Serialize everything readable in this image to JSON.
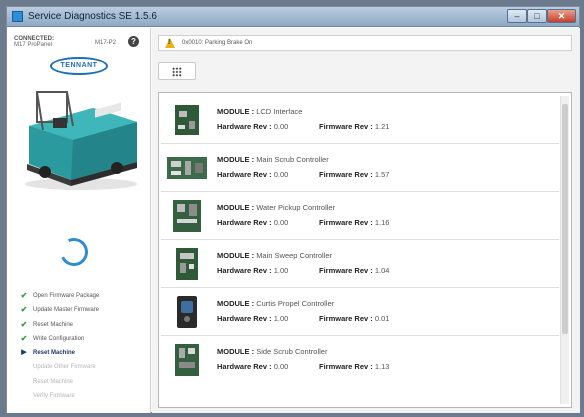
{
  "window": {
    "title": "Service Diagnostics SE 1.5.6",
    "min": "–",
    "max": "□",
    "close": "✕"
  },
  "connection": {
    "label": "CONNECTED:",
    "device": "M17 ProPanel",
    "model": "M17-P2",
    "help": "?"
  },
  "brand": {
    "logo": "TENNANT",
    "accent": "#1f6fb5"
  },
  "steps": [
    {
      "label": "Open Firmware Package",
      "state": "done",
      "mark": "✔"
    },
    {
      "label": "Update Master Firmware",
      "state": "done",
      "mark": "✔"
    },
    {
      "label": "Reset Machine",
      "state": "done",
      "mark": "✔"
    },
    {
      "label": "Write Configuration",
      "state": "done",
      "mark": "✔"
    },
    {
      "label": "Reset Machine",
      "state": "active",
      "mark": "▶"
    },
    {
      "label": "Update Other Firmware",
      "state": "pending",
      "mark": ""
    },
    {
      "label": "Reset Machine",
      "state": "pending",
      "mark": ""
    },
    {
      "label": "Verify Firmware",
      "state": "pending",
      "mark": ""
    }
  ],
  "alert": {
    "icon": "warning-icon",
    "text": "0x0010: Parking Brake On",
    "color": "#e8b21b"
  },
  "toolbar": {
    "grid_icon": "grid-icon"
  },
  "labels": {
    "module": "MODULE :",
    "hardware": "Hardware Rev :",
    "firmware": "Firmware Rev :"
  },
  "modules": [
    {
      "name": "LCD Interface",
      "hw": "0.00",
      "fw": "1.21"
    },
    {
      "name": "Main Scrub Controller",
      "hw": "0.00",
      "fw": "1.57"
    },
    {
      "name": "Water Pickup Controller",
      "hw": "0.00",
      "fw": "1.16"
    },
    {
      "name": "Main Sweep Controller",
      "hw": "1.00",
      "fw": "1.04"
    },
    {
      "name": "Curtis Propel Controller",
      "hw": "1.00",
      "fw": "0.01"
    },
    {
      "name": "Side Scrub Controller",
      "hw": "0.00",
      "fw": "1.13"
    }
  ]
}
